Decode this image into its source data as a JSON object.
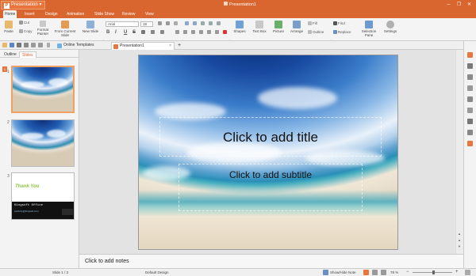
{
  "app": {
    "menu_label": "Presentation",
    "logo_glyph": "P",
    "doc_title": "Presentation1"
  },
  "window": {
    "minimize": "–",
    "restore": "❐",
    "close": "✕"
  },
  "tabs": [
    "Home",
    "Insert",
    "Design",
    "Animation",
    "Slide Show",
    "Review",
    "View"
  ],
  "ribbon": {
    "paste": "Paste",
    "cut": "Cut",
    "copy": "Copy",
    "format_painter": "Format Painter",
    "from_current_slide": "From Current Slide",
    "new_slide": "New Slide",
    "font_name": "Arial",
    "font_size": "18",
    "bold": "B",
    "italic": "I",
    "underline": "U",
    "strike": "S",
    "shapes": "Shapes",
    "text_box": "Text Box",
    "picture": "Picture",
    "arrange": "Arrange",
    "fill": "Fill",
    "outline": "Outline",
    "find": "Find",
    "replace": "Replace",
    "selection_pane": "Selection Pane",
    "settings": "Settings"
  },
  "quickbar": {
    "online_templates": "Online Templates",
    "doc_tab": "Presentation1",
    "close": "×",
    "add": "+"
  },
  "leftpane": {
    "tabs": [
      "Outline",
      "Slides"
    ],
    "slide_numbers": [
      "1",
      "2",
      "3"
    ],
    "badge": "1"
  },
  "thumb3": {
    "title": "Thank You",
    "line1": "Kingsoft Office",
    "line2": "publicity@kingsoft.com"
  },
  "slide": {
    "title_placeholder": "Click to add title",
    "subtitle_placeholder": "Click to add subtitle"
  },
  "notes": {
    "placeholder": "Click to add notes"
  },
  "status": {
    "slide_counter": "Slide 1 / 3",
    "design": "Default Design",
    "show_hide_note": "Show/Hide Note",
    "zoom": "78 %",
    "zoom_minus": "−",
    "zoom_plus": "+"
  },
  "colors": {
    "accent": "#d9662f",
    "ribbon_bg": "#f4f4f4"
  }
}
